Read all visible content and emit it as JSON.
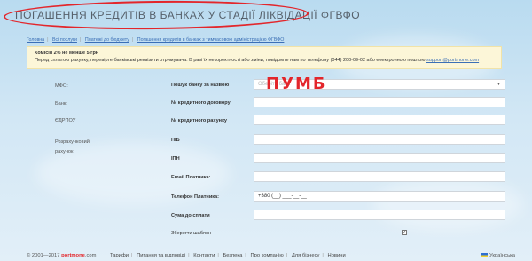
{
  "header": {
    "title": "Погашення кредитів в банках у стадії ліквідації ФГВФО"
  },
  "breadcrumb": [
    "Головна",
    "Всі послуги",
    "Платежі до бюджету",
    "Погашення кредитів в банках з тимчасовою адміністрацією ФГВФО"
  ],
  "notice": {
    "title": "Комісія 2% не менше 5 грн",
    "text": "Перед сплатою рахунку, перевірте банківські реквізити отримувача. В разі їх некоректності або зміни, повідомте нам по телефону (044) 200-09-02 або електронною поштою",
    "email": "support@portmone.com"
  },
  "left_labels": {
    "mfo": "МФО:",
    "bank": "Банк:",
    "edrpou": "ЄДРПОУ",
    "account": "Розрахунковий рахунок:"
  },
  "form": {
    "search_bank_label": "Пошук банку за назвою",
    "search_bank_value": "ПУМБ",
    "search_bank_placeholder": "Оберіть банк",
    "loan_contract_label": "№ кредитного договору",
    "loan_account_label": "№ кредитного рахунку",
    "pib_label": "ПІБ",
    "ipn_label": "ІПН",
    "email_label": "Email Платника:",
    "phone_label": "Телефон Платника:",
    "phone_value": "+380 (__) ___-__-__",
    "amount_label": "Сума до сплати",
    "save_template_label": "Зберегти шаблон",
    "save_template_checked": "✓"
  },
  "footer": {
    "copyright": "© 2001—2017",
    "brand": "portmone",
    "brand_suffix": ".com",
    "nav": [
      "Тарифи",
      "Питання та відповіді",
      "Контакти",
      "Безпека",
      "Про компанію",
      "Для бізнесу",
      "Новини"
    ],
    "language": "Українська"
  }
}
